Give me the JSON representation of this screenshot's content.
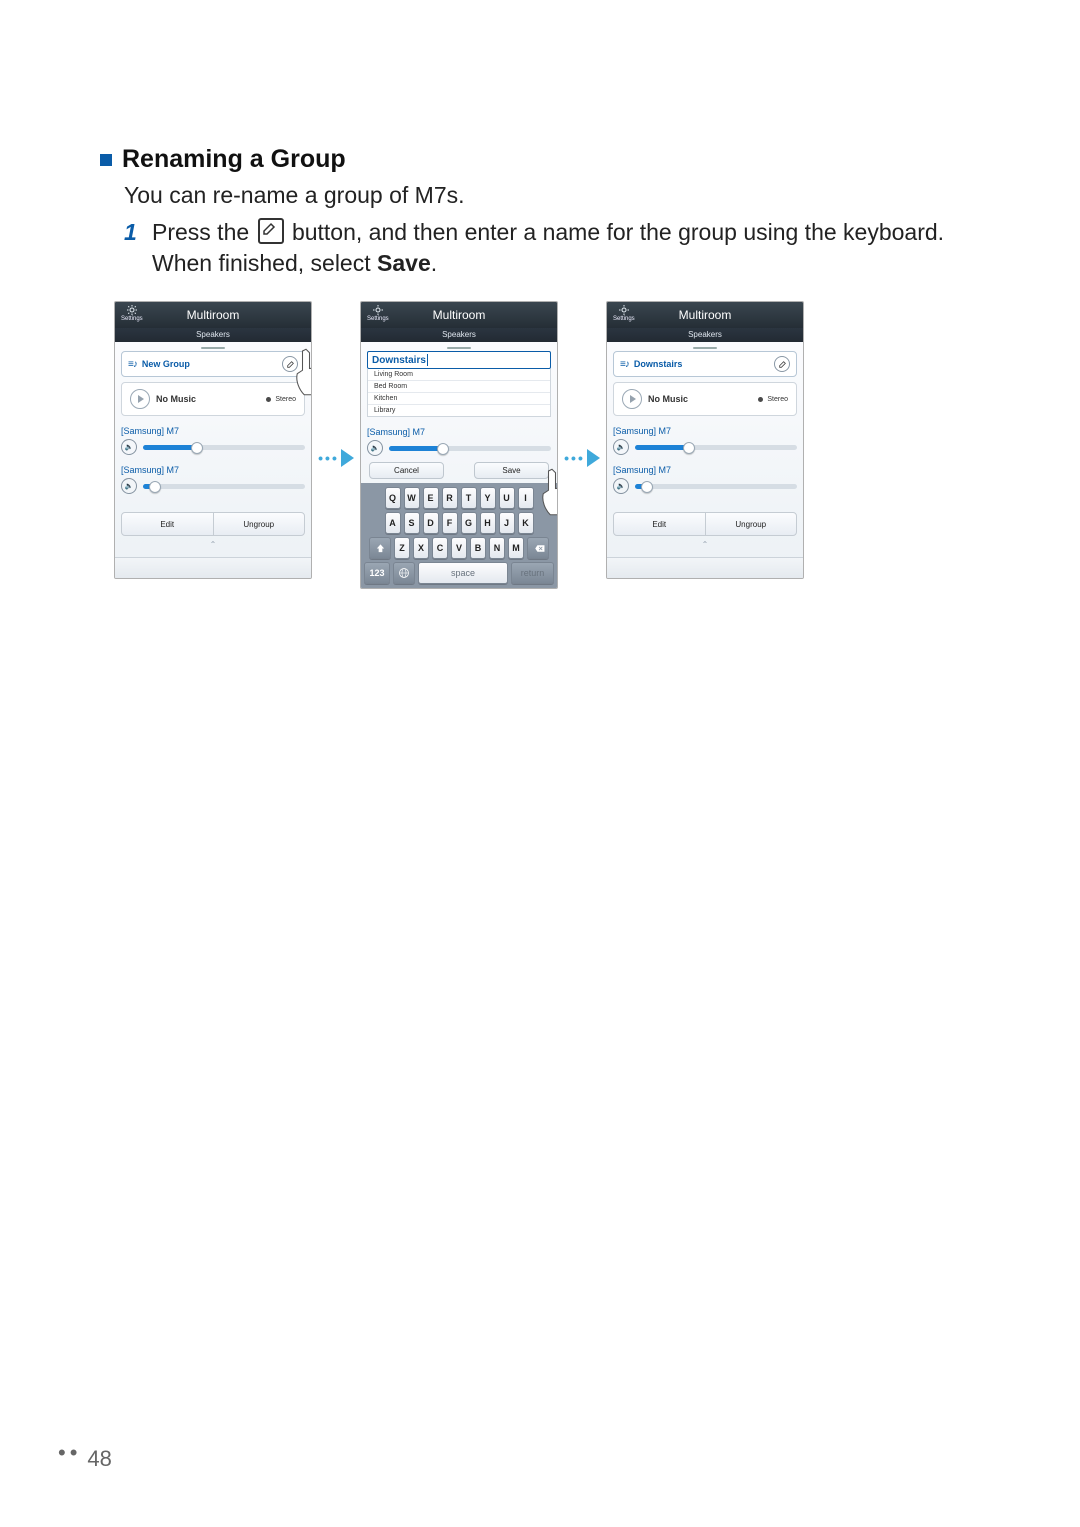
{
  "section": {
    "title": "Renaming a Group",
    "intro": "You can re-name a group of M7s.",
    "step_number": "1",
    "step_pre": "Press the ",
    "step_post": " button, and then enter a name for the group using the keyboard. When finished, select ",
    "step_bold": "Save",
    "step_end": "."
  },
  "header": {
    "app_title": "Multiroom",
    "tab_label": "Speakers",
    "settings_label": "Settings"
  },
  "shot1": {
    "group_name": "New Group",
    "no_music": "No Music",
    "stereo": "Stereo",
    "speaker_name": "[Samsung] M7",
    "vol1": 33,
    "vol2": 7,
    "edit": "Edit",
    "ungroup": "Ungroup"
  },
  "shot2": {
    "input_value": "Downstairs",
    "suggestions": [
      "Living Room",
      "Bed Room",
      "Kitchen",
      "Library"
    ],
    "speaker_name": "[Samsung] M7",
    "vol": 33,
    "cancel": "Cancel",
    "save": "Save",
    "kb_row1": [
      "Q",
      "W",
      "E",
      "R",
      "T",
      "Y",
      "U",
      "I"
    ],
    "kb_row2": [
      "A",
      "S",
      "D",
      "F",
      "G",
      "H",
      "J",
      "K"
    ],
    "kb_row3": [
      "Z",
      "X",
      "C",
      "V",
      "B",
      "N",
      "M"
    ],
    "kb_123": "123",
    "kb_space": "space",
    "kb_return": "return"
  },
  "shot3": {
    "group_name": "Downstairs",
    "no_music": "No Music",
    "stereo": "Stereo",
    "speaker_name": "[Samsung] M7",
    "vol1": 33,
    "vol2": 7,
    "edit": "Edit",
    "ungroup": "Ungroup"
  },
  "page_number": "48"
}
